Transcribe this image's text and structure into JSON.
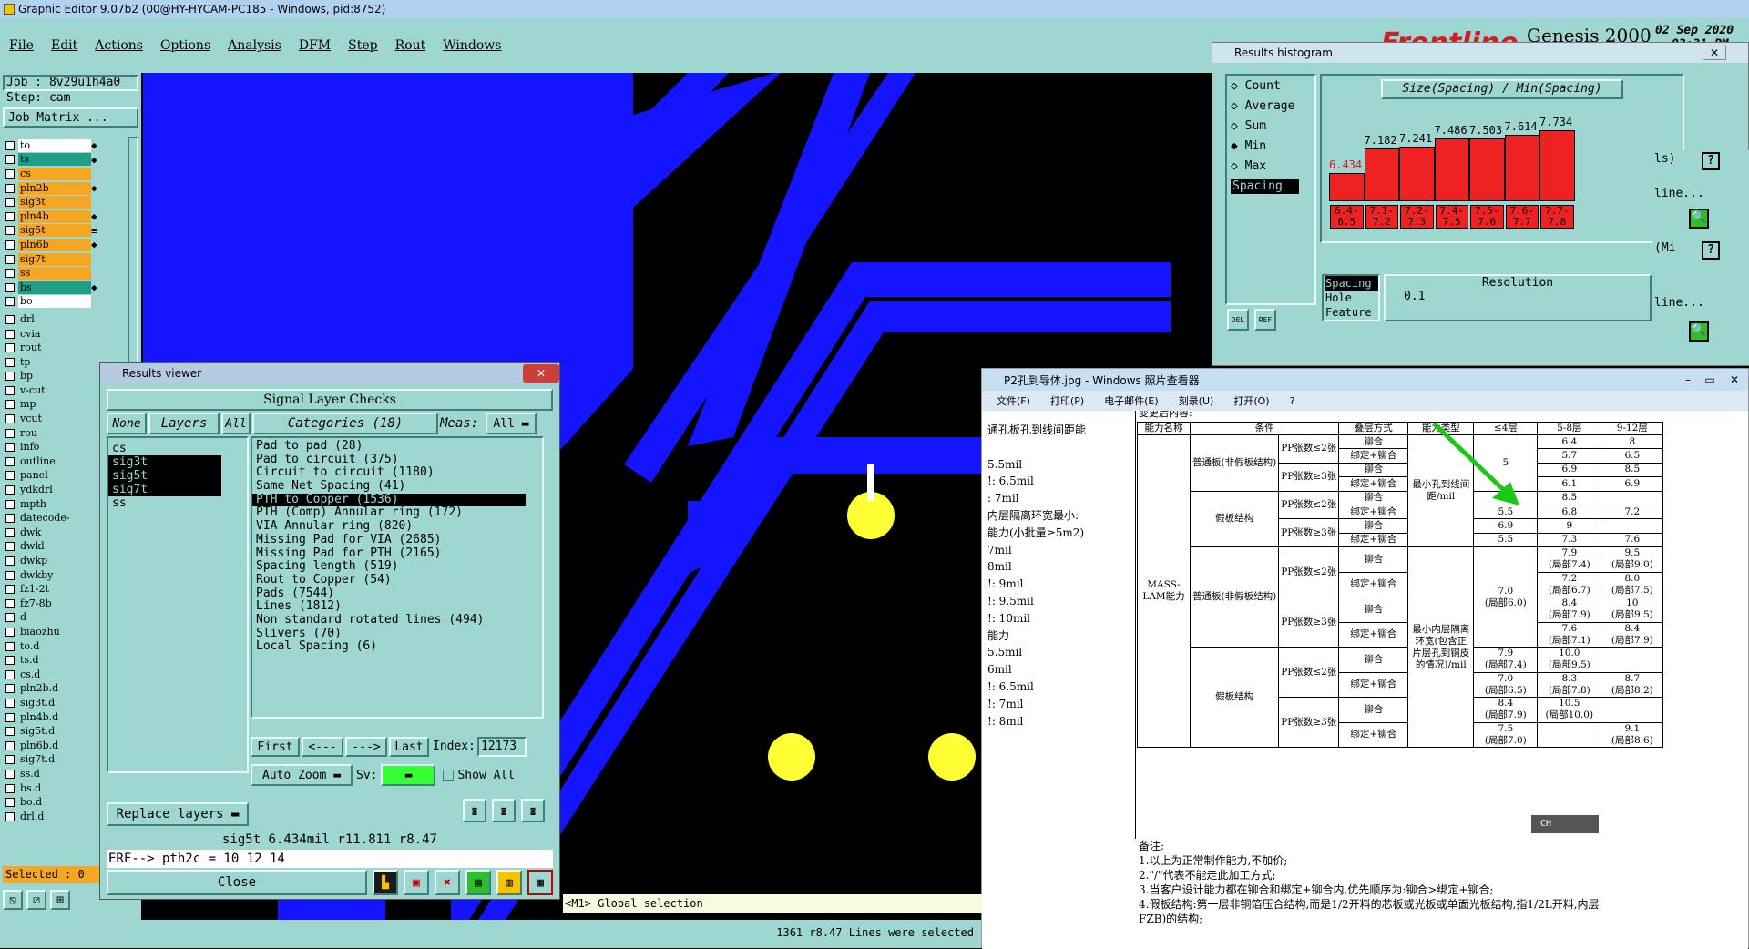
{
  "app": {
    "title": "Graphic Editor 9.07b2 (00@HY-HYCAM-PC185 - Windows, pid:8752)",
    "window_controls": [
      "_",
      "□",
      "×"
    ]
  },
  "menu": [
    "File",
    "Edit",
    "Actions",
    "Options",
    "Analysis",
    "DFM",
    "Step",
    "Rout",
    "Windows"
  ],
  "brand": {
    "logo": "Frontline",
    "product": "Genesis 2000",
    "date": "02 Sep 2020",
    "time": "03:31 PM"
  },
  "job": {
    "job": "Job : 8v29u1h4a0",
    "step": "Step: cam",
    "matrix_btn": "Job Matrix ..."
  },
  "layers": [
    {
      "name": "to",
      "color": "#ffffff",
      "sym": "◆"
    },
    {
      "name": "ts",
      "color": "#1f9f86",
      "sym": "◆"
    },
    {
      "name": "cs",
      "color": "#f5a623",
      "sym": ""
    },
    {
      "name": "pln2b",
      "color": "#f5a623",
      "sym": "◆"
    },
    {
      "name": "sig3t",
      "color": "#f5a623",
      "sym": ""
    },
    {
      "name": "pln4b",
      "color": "#f5a623",
      "sym": "◆"
    },
    {
      "name": "sig5t",
      "color": "#f5a623",
      "sym": "≡"
    },
    {
      "name": "pln6b",
      "color": "#f5a623",
      "sym": "◆"
    },
    {
      "name": "sig7t",
      "color": "#f5a623",
      "sym": ""
    },
    {
      "name": "ss",
      "color": "#f5a623",
      "sym": ""
    },
    {
      "name": "bs",
      "color": "#1f9f86",
      "sym": "◆"
    },
    {
      "name": "bo",
      "color": "#ffffff",
      "sym": ""
    }
  ],
  "layers2": [
    "drl",
    "cvia",
    "rout",
    "tp",
    "bp",
    "v-cut",
    "mp",
    "vcut",
    "rou",
    "info",
    "outline",
    "panel",
    "ydkdrl",
    "mpth",
    "datecode-",
    "dwk",
    "dwkl",
    "dwkp",
    "dwkby",
    "fz1-2t",
    "fz7-8b",
    "d",
    "biaozhu",
    "to.d",
    "ts.d",
    "cs.d",
    "pln2b.d",
    "sig3t.d",
    "pln4b.d",
    "sig5t.d",
    "pln6b.d",
    "sig7t.d",
    "ss.d",
    "bs.d",
    "bo.d",
    "drl.d"
  ],
  "selected": "Selected : 0",
  "results_viewer": {
    "title": "Results viewer",
    "header": "Signal Layer Checks",
    "none": "None",
    "layers": "Layers",
    "all": "All",
    "categories": "Categories (18)",
    "meas": "Meas:",
    "meas_val": "All",
    "layer_list": [
      "cs",
      "sig3t",
      "sig5t",
      "sig7t",
      "ss"
    ],
    "category_list": [
      "Pad to pad (28)",
      "Pad to circuit (375)",
      "Circuit to circuit (1180)",
      "Same Net Spacing (41)",
      "PTH to Copper (1536)",
      "PTH (Comp) Annular ring (172)",
      "VIA Annular ring (820)",
      "Missing Pad for VIA (2685)",
      "Missing Pad for PTH (2165)",
      "Spacing length (519)",
      "Rout to Copper (54)",
      "Pads (7544)",
      "Lines (1812)",
      "Non standard rotated lines (494)",
      "Slivers (70)",
      "Local Spacing (6)"
    ],
    "nav": [
      "First",
      "<---",
      "--->",
      "Last"
    ],
    "index_label": "Index:",
    "index_val": "12173",
    "autozoom": "Auto Zoom",
    "sv": "Sv:",
    "showall": "Show All",
    "replace": "Replace layers",
    "info": "sig5t  6.434mil  r11.811  r8.47",
    "erf": "ERF--> pth2c = 10 12 14",
    "close": "Close"
  },
  "histogram": {
    "title": "Results histogram",
    "options": [
      "Count",
      "Average",
      "Sum",
      "Min",
      "Max"
    ],
    "selected_option": "Min",
    "list_item": "Spacing",
    "header": "Size(Spacing) / Min(Spacing)",
    "bars": [
      {
        "label": "6.434",
        "value": 6.434,
        "bin": "6.4-6.5"
      },
      {
        "label": "7.182",
        "value": 7.182,
        "bin": "7.1-7.2"
      },
      {
        "label": "7.241",
        "value": 7.241,
        "bin": "7.2-7.3"
      },
      {
        "label": "7.486",
        "value": 7.486,
        "bin": "7.4-7.5"
      },
      {
        "label": "7.503",
        "value": 7.503,
        "bin": "7.5-7.6"
      },
      {
        "label": "7.614",
        "value": 7.614,
        "bin": "7.6-7.7"
      },
      {
        "label": "7.734",
        "value": 7.734,
        "bin": "7.7-7.8"
      }
    ],
    "sel_list": [
      "Spacing",
      "Hole",
      "Feature"
    ],
    "resolution_label": "Resolution",
    "resolution": "0.1",
    "del": "DEL",
    "ref": "REF"
  },
  "right_side": {
    "ls": "ls)",
    "mi": "(Mi",
    "line1": "line...",
    "line2": "line..."
  },
  "photo_viewer": {
    "title": "P2孔到导体.jpg - Windows 照片查看器",
    "menu": [
      "文件(F)",
      "打印(P)",
      "电子邮件(E)",
      "刻录(U)",
      "打开(O)"
    ],
    "help": "?",
    "cut_top": "变更后内容:",
    "left_lines": [
      "通孔板孔到线间距能",
      "",
      "5.5mil",
      "!: 6.5mil",
      ": 7mil",
      "内层隔离环宽最小:",
      "能力(小批量≥5m2)",
      "7mil",
      "8mil",
      "!: 9mil",
      "!: 9.5mil",
      "!: 10mil",
      "能力",
      "5.5mil",
      "6mil",
      "!: 6.5mil",
      "!: 7mil",
      "!: 8mil"
    ],
    "table_head": [
      "能力名称",
      "条件",
      "",
      "叠层方式",
      "能力类型",
      "≤4层",
      "5-8层",
      "9-12层"
    ],
    "row_labels": {
      "cap": "MASS-LAM能力",
      "normal": "普通板(非假板结构)",
      "fake": "假板结构",
      "pp2": "PP张数≤2张",
      "pp3": "PP张数≥3张",
      "rivet": "铆合",
      "bond": "绑定+铆合",
      "type1": "最小孔到线间距/mil",
      "type2": "最小内层隔离环宽(包含正片层孔到铜皮的情况)/mil"
    },
    "block1": [
      [
        "5",
        "6.4",
        "8"
      ],
      [
        "",
        "5.7",
        "6.5"
      ],
      [
        "",
        "6.9",
        "8.5"
      ],
      [
        "",
        "6.1",
        "6.9"
      ],
      [
        "6.4",
        "8.5",
        ""
      ],
      [
        "5.5",
        "6.8",
        "7.2"
      ],
      [
        "6.9",
        "9",
        ""
      ],
      [
        "5.5",
        "7.3",
        "7.6"
      ]
    ],
    "block2": [
      [
        "7.9\n(局部7.4)",
        "9.5\n(局部9.0)"
      ],
      [
        "7.2\n(局部6.7)",
        "8.0\n(局部7.5)"
      ],
      [
        "8.4\n(局部7.9)",
        "10\n(局部9.5)"
      ],
      [
        "7.6\n(局部7.1)",
        "8.4\n(局部7.9)"
      ],
      [
        "10.0\n(局部9.5)",
        ""
      ],
      [
        "8.3\n(局部7.8)",
        "8.7\n(局部8.2)"
      ],
      [
        "10.5\n(局部10.0)",
        ""
      ],
      [
        "",
        ""
      ]
    ],
    "block2_first": "7.0\n(局部6.0)",
    "block3_first": [
      [
        "7.9\n(局部7.4)"
      ],
      [
        "7.0\n(局部6.5)"
      ],
      [
        "8.4\n(局部7.9)"
      ],
      [
        "7.5\n(局部7.0)"
      ]
    ],
    "block3_last": "9.1\n(局部8.6)",
    "notes": [
      "备注:",
      "1.以上为正常制作能力,不加价;",
      "2.\"/\"代表不能走此加工方式;",
      "3.当客户设计能力都在铆合和绑定+铆合内,优先顺序为:铆合>绑定+铆合;",
      "4.假板结构:第一层非铜箔压合结构,而是1/2开料的芯板或光板或单面光板结构,指1/2L开料,内层",
      "FZB)的结构;"
    ],
    "ime": "CH"
  },
  "status": {
    "global": "<M1> Global selection",
    "bottom": "1361  r8.47  Lines were selected"
  }
}
